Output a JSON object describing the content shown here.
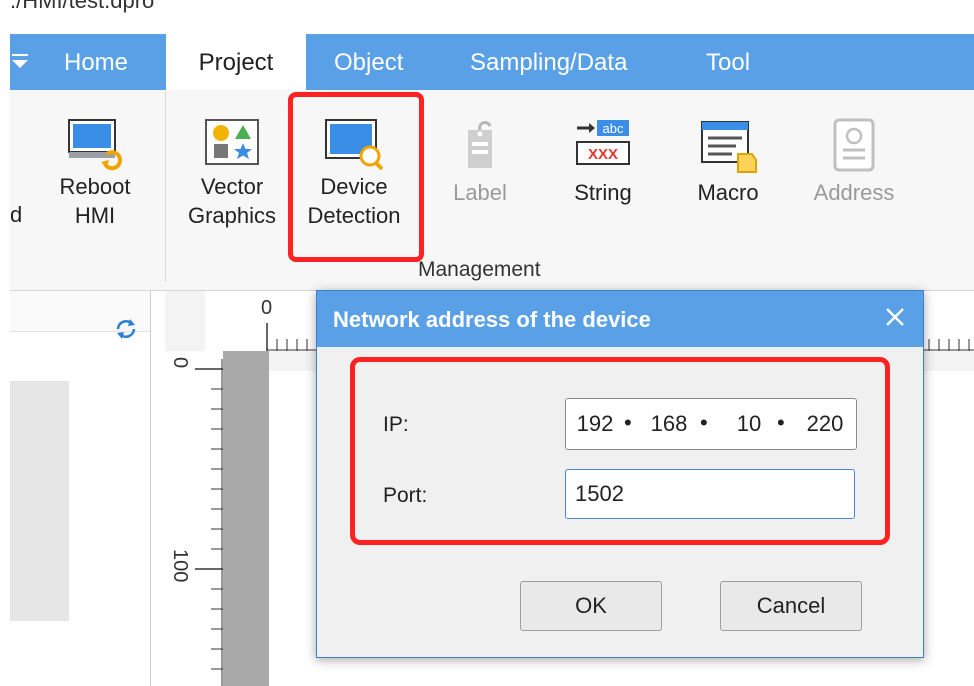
{
  "window": {
    "title": "./HMI/test.dpro"
  },
  "tabs": [
    {
      "label": "Home"
    },
    {
      "label": "Project"
    },
    {
      "label": "Object"
    },
    {
      "label": "Sampling/Data"
    },
    {
      "label": "Tool"
    }
  ],
  "ribbon": {
    "partial_label": "d",
    "buttons": {
      "reboot": "Reboot\nHMI",
      "vector": "Vector\nGraphics",
      "device": "Device\nDetection",
      "label": "Label",
      "string": "String",
      "string_icon_text": "abc",
      "string_icon_text2": "XXX",
      "macro": "Macro",
      "address": "Address"
    },
    "group_label": "Management"
  },
  "ruler": {
    "h_zero": "0",
    "v_zero": "0",
    "v_hundred": "100"
  },
  "dialog": {
    "title": "Network address of the device",
    "ip_label": "IP:",
    "ip": [
      "192",
      "168",
      "10",
      "220"
    ],
    "port_label": "Port:",
    "port_value": "1502",
    "ok": "OK",
    "cancel": "Cancel"
  },
  "colors": {
    "accent": "#5aa0e6",
    "highlight": "#ff2222"
  }
}
